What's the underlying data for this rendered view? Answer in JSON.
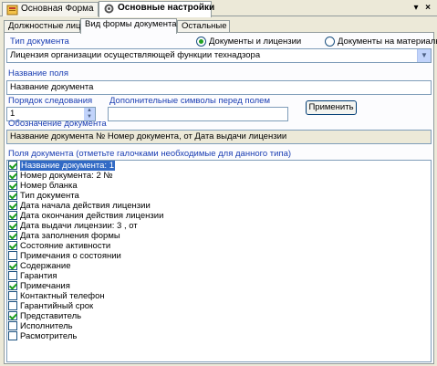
{
  "doc_tabs": [
    {
      "label": "Основная Форма"
    },
    {
      "label": "Основные настройки"
    }
  ],
  "icons": {
    "pin": "▾",
    "close": "×",
    "combo_arrow": "▼",
    "spin_up": "▲",
    "spin_down": "▼"
  },
  "inner_tabs": [
    {
      "label": "Должностные лица"
    },
    {
      "label": "Вид формы документа"
    },
    {
      "label": "Остальные"
    }
  ],
  "doc_type": {
    "label": "Тип документа",
    "options": [
      {
        "label": "Документы и лицензии",
        "selected": true
      },
      {
        "label": "Документы на материалы",
        "selected": false
      }
    ],
    "combo_value": "Лицензия организации осуществляющей функции технадзора"
  },
  "field_name": {
    "label": "Название поля",
    "value": "Название документа"
  },
  "order": {
    "label": "Порядок следования",
    "value": "1"
  },
  "extra_symbols": {
    "label": "Дополнительные символы перед полем",
    "value": ""
  },
  "apply_label": "Применить",
  "designation": {
    "label": "Обозначение документа",
    "value": "Название документа № Номер документа, от Дата выдачи лицензии"
  },
  "fields_list": {
    "label": "Поля документа (отметьте галочками необходимые для данного типа)",
    "items": [
      {
        "label": "Название документа: 1",
        "checked": true,
        "selected": true
      },
      {
        "label": "Номер документа: 2  №",
        "checked": true,
        "selected": false
      },
      {
        "label": "Номер бланка",
        "checked": true,
        "selected": false
      },
      {
        "label": "Тип документа",
        "checked": true,
        "selected": false
      },
      {
        "label": "Дата начала действия лицензии",
        "checked": true,
        "selected": false
      },
      {
        "label": "Дата окончания действия лицензии",
        "checked": true,
        "selected": false
      },
      {
        "label": "Дата выдачи лицензии: 3 , от",
        "checked": true,
        "selected": false
      },
      {
        "label": "Дата заполнения формы",
        "checked": true,
        "selected": false
      },
      {
        "label": "Состояние активности",
        "checked": true,
        "selected": false
      },
      {
        "label": "Примечания о состоянии",
        "checked": false,
        "selected": false
      },
      {
        "label": "Содержание",
        "checked": true,
        "selected": false
      },
      {
        "label": "Гарантия",
        "checked": false,
        "selected": false
      },
      {
        "label": "Примечания",
        "checked": true,
        "selected": false
      },
      {
        "label": "Контактный телефон",
        "checked": false,
        "selected": false
      },
      {
        "label": "Гарантийный срок",
        "checked": false,
        "selected": false
      },
      {
        "label": "Представитель",
        "checked": true,
        "selected": false
      },
      {
        "label": "Исполнитель",
        "checked": false,
        "selected": false
      },
      {
        "label": "Расмотритель",
        "checked": false,
        "selected": false
      }
    ]
  }
}
